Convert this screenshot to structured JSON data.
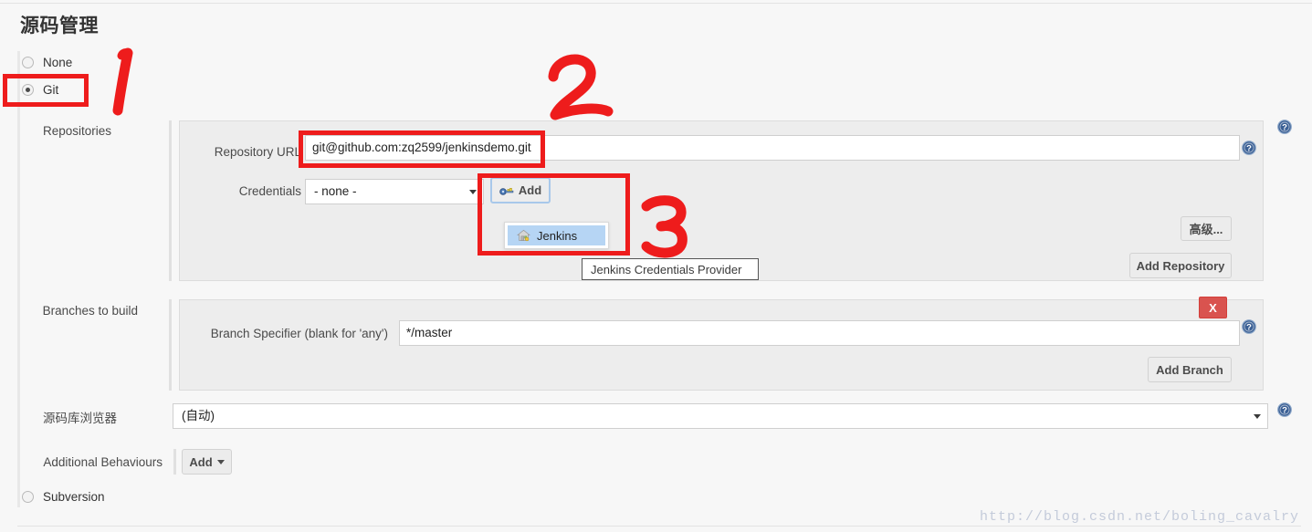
{
  "page": {
    "title": "源码管理",
    "watermark": "http://blog.csdn.net/boling_cavalry"
  },
  "scm_options": [
    {
      "label": "None",
      "selected": false
    },
    {
      "label": "Git",
      "selected": true
    },
    {
      "label": "Subversion",
      "selected": false
    }
  ],
  "git": {
    "repositories": {
      "label": "Repositories",
      "repository_url": {
        "label": "Repository URL",
        "value": "git@github.com:zq2599/jenkinsdemo.git"
      },
      "credentials": {
        "label": "Credentials",
        "value": "- none -",
        "add_button": "Add",
        "add_button_icon": "key-icon",
        "menu": {
          "items": [
            {
              "label": "Jenkins",
              "icon": "jenkins-house-icon",
              "highlighted": true
            }
          ],
          "tooltip": "Jenkins Credentials Provider"
        }
      },
      "advanced_button": "高级...",
      "add_repository_button": "Add Repository"
    },
    "branches": {
      "label": "Branches to build",
      "branch_specifier": {
        "label": "Branch Specifier (blank for 'any')",
        "value": "*/master"
      },
      "delete_button": "X",
      "add_branch_button": "Add Branch"
    },
    "repository_browser": {
      "label": "源码库浏览器",
      "value": "(自动)"
    },
    "additional_behaviours": {
      "label": "Additional Behaviours",
      "add_button": "Add"
    }
  },
  "annotations": [
    {
      "name": "git-radio-highlight",
      "number": ""
    },
    {
      "name": "marker-1",
      "number": "1"
    },
    {
      "name": "repository-url-highlight",
      "number": ""
    },
    {
      "name": "marker-2",
      "number": "2"
    },
    {
      "name": "credentials-add-highlight",
      "number": ""
    },
    {
      "name": "marker-3",
      "number": "3"
    }
  ],
  "icons": {
    "help": "help-icon",
    "key": "key-icon",
    "house": "jenkins-house-icon",
    "caret_down": "chevron-down-icon"
  },
  "colors": {
    "annotation_red": "#ee1c1c",
    "danger_red": "#d9534f",
    "help_blue": "#3a5f94",
    "menu_highlight": "#b6d5f4",
    "panel_bg": "#ededed",
    "page_bg": "#f7f7f7"
  }
}
